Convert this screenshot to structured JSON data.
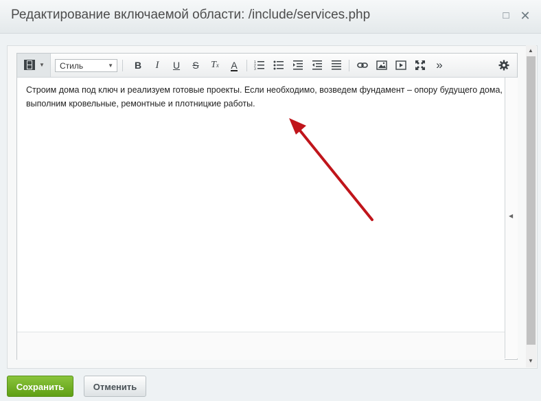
{
  "window": {
    "title": "Редактирование включаемой области: /include/services.php",
    "maximize_glyph": "□",
    "close_glyph": "✕"
  },
  "toolbar": {
    "view_icon": "film-icon",
    "style_select": {
      "selected": "Стиль"
    },
    "buttons": [
      {
        "name": "bold",
        "glyph": "B"
      },
      {
        "name": "italic",
        "glyph": "I"
      },
      {
        "name": "underline",
        "glyph": "U"
      },
      {
        "name": "strikethrough",
        "glyph": "S"
      },
      {
        "name": "remove-format",
        "glyph": "Tx"
      },
      {
        "name": "font-color",
        "glyph": "A"
      },
      {
        "name": "ordered-list",
        "glyph": "ordered-list-icon"
      },
      {
        "name": "unordered-list",
        "glyph": "unordered-list-icon"
      },
      {
        "name": "indent",
        "glyph": "indent-icon"
      },
      {
        "name": "outdent",
        "glyph": "outdent-icon"
      },
      {
        "name": "align",
        "glyph": "align-icon"
      },
      {
        "name": "link",
        "glyph": "link-icon"
      },
      {
        "name": "image",
        "glyph": "image-icon"
      },
      {
        "name": "video",
        "glyph": "video-icon"
      },
      {
        "name": "fullscreen",
        "glyph": "fullscreen-icon"
      },
      {
        "name": "more",
        "glyph": "»"
      },
      {
        "name": "settings",
        "glyph": "gear-icon"
      }
    ],
    "more_glyph": "»"
  },
  "editor": {
    "text": "Строим дома под ключ и реализуем готовые проекты. Если необходимо, возведем фундамент – опору будущего дома, выполним кровельные, ремонтные и плотницкие работы."
  },
  "footer": {
    "save_label": "Сохранить",
    "cancel_label": "Отменить"
  },
  "colors": {
    "save_button": "#6aaa1e",
    "annotation_arrow": "#c0151b"
  }
}
